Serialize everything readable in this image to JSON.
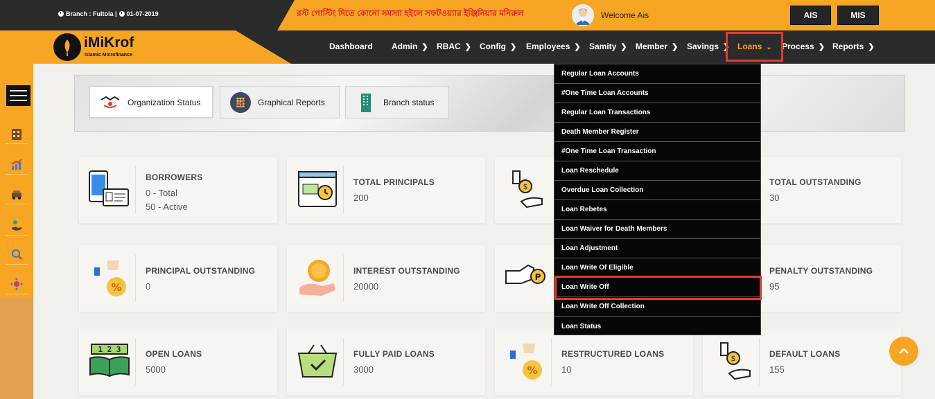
{
  "header": {
    "branch_info": "Branch : Fultola |",
    "date": "01-07-2019",
    "notice": "রস্ট পোস্টিং দিতে কোনো সমস্যা হইলে সফটওয়্যার ইঞ্জিনিয়ার মনিরুল",
    "welcome": "Welcome Ais",
    "ais_button": "AIS",
    "mis_button": "MIS"
  },
  "logo": {
    "title": "iMiKrof",
    "subtitle": "Islamic Microfinance"
  },
  "nav": {
    "items": [
      {
        "label": "Dashboard"
      },
      {
        "label": "Admin"
      },
      {
        "label": "RBAC"
      },
      {
        "label": "Config"
      },
      {
        "label": "Employees"
      },
      {
        "label": "Samity"
      },
      {
        "label": "Member"
      },
      {
        "label": "Savings"
      },
      {
        "label": "Loans"
      },
      {
        "label": "Process"
      },
      {
        "label": "Reports"
      }
    ]
  },
  "tabs": [
    {
      "label": "Organization Status",
      "icon": "handshake-icon"
    },
    {
      "label": "Graphical Reports",
      "icon": "chart-grid-icon"
    },
    {
      "label": "Branch status",
      "icon": "building-icon"
    }
  ],
  "loans_menu": [
    "Regular Loan Accounts",
    "#One Time Loan Accounts",
    "Regular Loan Transactions",
    "Death Member Register",
    "#One Time Loan Transaction",
    "Loan Reschedule",
    "Overdue Loan Collection",
    "Loan Rebetes",
    "Loan Waiver for Death Members",
    "Loan Adjustment",
    "Loan Write Of Eligible",
    "Loan Write Off",
    "Loan Write Off Collection",
    "Loan Status"
  ],
  "cards": {
    "borrowers": {
      "title": "BORROWERS",
      "line1": "0 - Total",
      "line2": "50 - Active"
    },
    "total_principals": {
      "title": "TOTAL PRINCIPALS",
      "value": "200"
    },
    "total_outstanding": {
      "title": "TOTAL OUTSTANDING",
      "value": "30"
    },
    "principal_outstanding": {
      "title": "PRINCIPAL OUTSTANDING",
      "value": "0"
    },
    "interest_outstanding": {
      "title": "INTEREST OUTSTANDING",
      "value": "20000"
    },
    "penalty_outstanding": {
      "title": "PENALTY OUTSTANDING",
      "value": "95"
    },
    "open_loans": {
      "title": "OPEN LOANS",
      "value": "5000",
      "icon_text": "1 2 3"
    },
    "fully_paid_loans": {
      "title": "FULLY PAID LOANS",
      "value": "3000"
    },
    "restructured_loans": {
      "title": "RESTRUCTURED LOANS",
      "value": "10"
    },
    "default_loans": {
      "title": "DEFAULT LOANS",
      "value": "155"
    }
  },
  "colors": {
    "accent": "#f6a623",
    "dark": "#2b2b2b",
    "highlight": "#e53a2c"
  }
}
